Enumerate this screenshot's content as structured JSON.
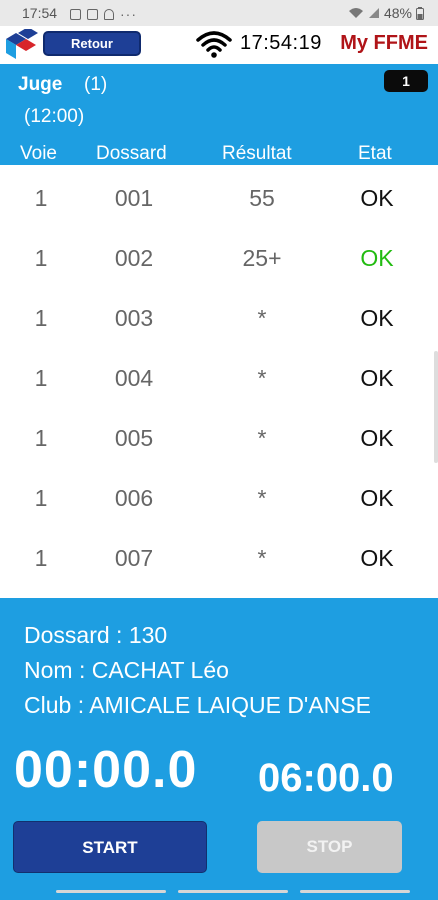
{
  "status_bar": {
    "time": "17:54",
    "battery": "48%",
    "icons": [
      "image-icon",
      "message-icon",
      "bell-icon",
      "more-icon",
      "wifi-icon",
      "signal-icon",
      "battery-icon"
    ]
  },
  "app_bar": {
    "back_label": "Retour",
    "clock": "17:54:19",
    "brand": "My FFME"
  },
  "header": {
    "judge_label": "Juge",
    "judge_number": "(1)",
    "time_slot": "(12:00)",
    "counter": "1",
    "columns": [
      "Voie",
      "Dossard",
      "Résultat",
      "Etat"
    ]
  },
  "rows": [
    {
      "voie": "1",
      "dossard": "001",
      "resultat": "55",
      "etat": "OK",
      "etat_color": "#111111"
    },
    {
      "voie": "1",
      "dossard": "002",
      "resultat": "25+",
      "etat": "OK",
      "etat_color": "#22bb11"
    },
    {
      "voie": "1",
      "dossard": "003",
      "resultat": "*",
      "etat": "OK",
      "etat_color": "#111111"
    },
    {
      "voie": "1",
      "dossard": "004",
      "resultat": "*",
      "etat": "OK",
      "etat_color": "#111111"
    },
    {
      "voie": "1",
      "dossard": "005",
      "resultat": "*",
      "etat": "OK",
      "etat_color": "#111111"
    },
    {
      "voie": "1",
      "dossard": "006",
      "resultat": "*",
      "etat": "OK",
      "etat_color": "#111111"
    },
    {
      "voie": "1",
      "dossard": "007",
      "resultat": "*",
      "etat": "OK",
      "etat_color": "#111111"
    }
  ],
  "climber": {
    "dossard": "Dossard : 130",
    "nom": "Nom : CACHAT Léo",
    "club": "Club : AMICALE LAIQUE D'ANSE"
  },
  "timers": {
    "elapsed": "00:00.0",
    "limit": "06:00.0"
  },
  "buttons": {
    "start": "START",
    "stop": "STOP"
  },
  "colors": {
    "header_blue": "#1e9ee1",
    "button_navy": "#1e3f96",
    "brand_red": "#b01418",
    "ok_green": "#22bb11",
    "stop_disabled": "#c8c8c8"
  }
}
